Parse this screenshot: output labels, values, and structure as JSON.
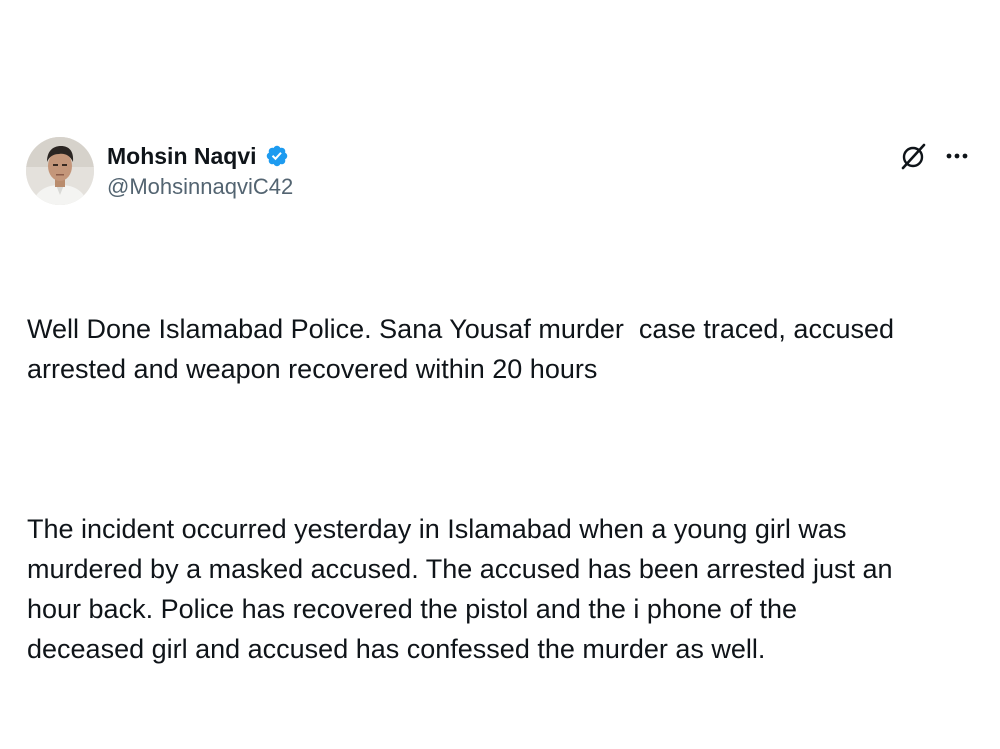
{
  "author": {
    "display_name": "Mohsin Naqvi",
    "handle": "@MohsinnaqviC42",
    "verified": true,
    "avatar": "profile-photo"
  },
  "actions": {
    "grok_icon": "grok-icon",
    "more_icon": "more-icon"
  },
  "tweet": {
    "paragraph_1": "Well Done Islamabad Police. Sana Yousaf murder  case traced, accused\narrested and weapon recovered within 20 hours",
    "paragraph_2": "The incident occurred yesterday in Islamabad when a young girl was\nmurdered by a masked accused. The accused has been arrested just an\nhour back. Police has recovered the pistol and the i phone of the\ndeceased girl and accused has confessed the murder as well."
  },
  "colors": {
    "text": "#0f1419",
    "secondary_text": "#536471",
    "verified_blue": "#1d9bf0",
    "background": "#ffffff"
  }
}
